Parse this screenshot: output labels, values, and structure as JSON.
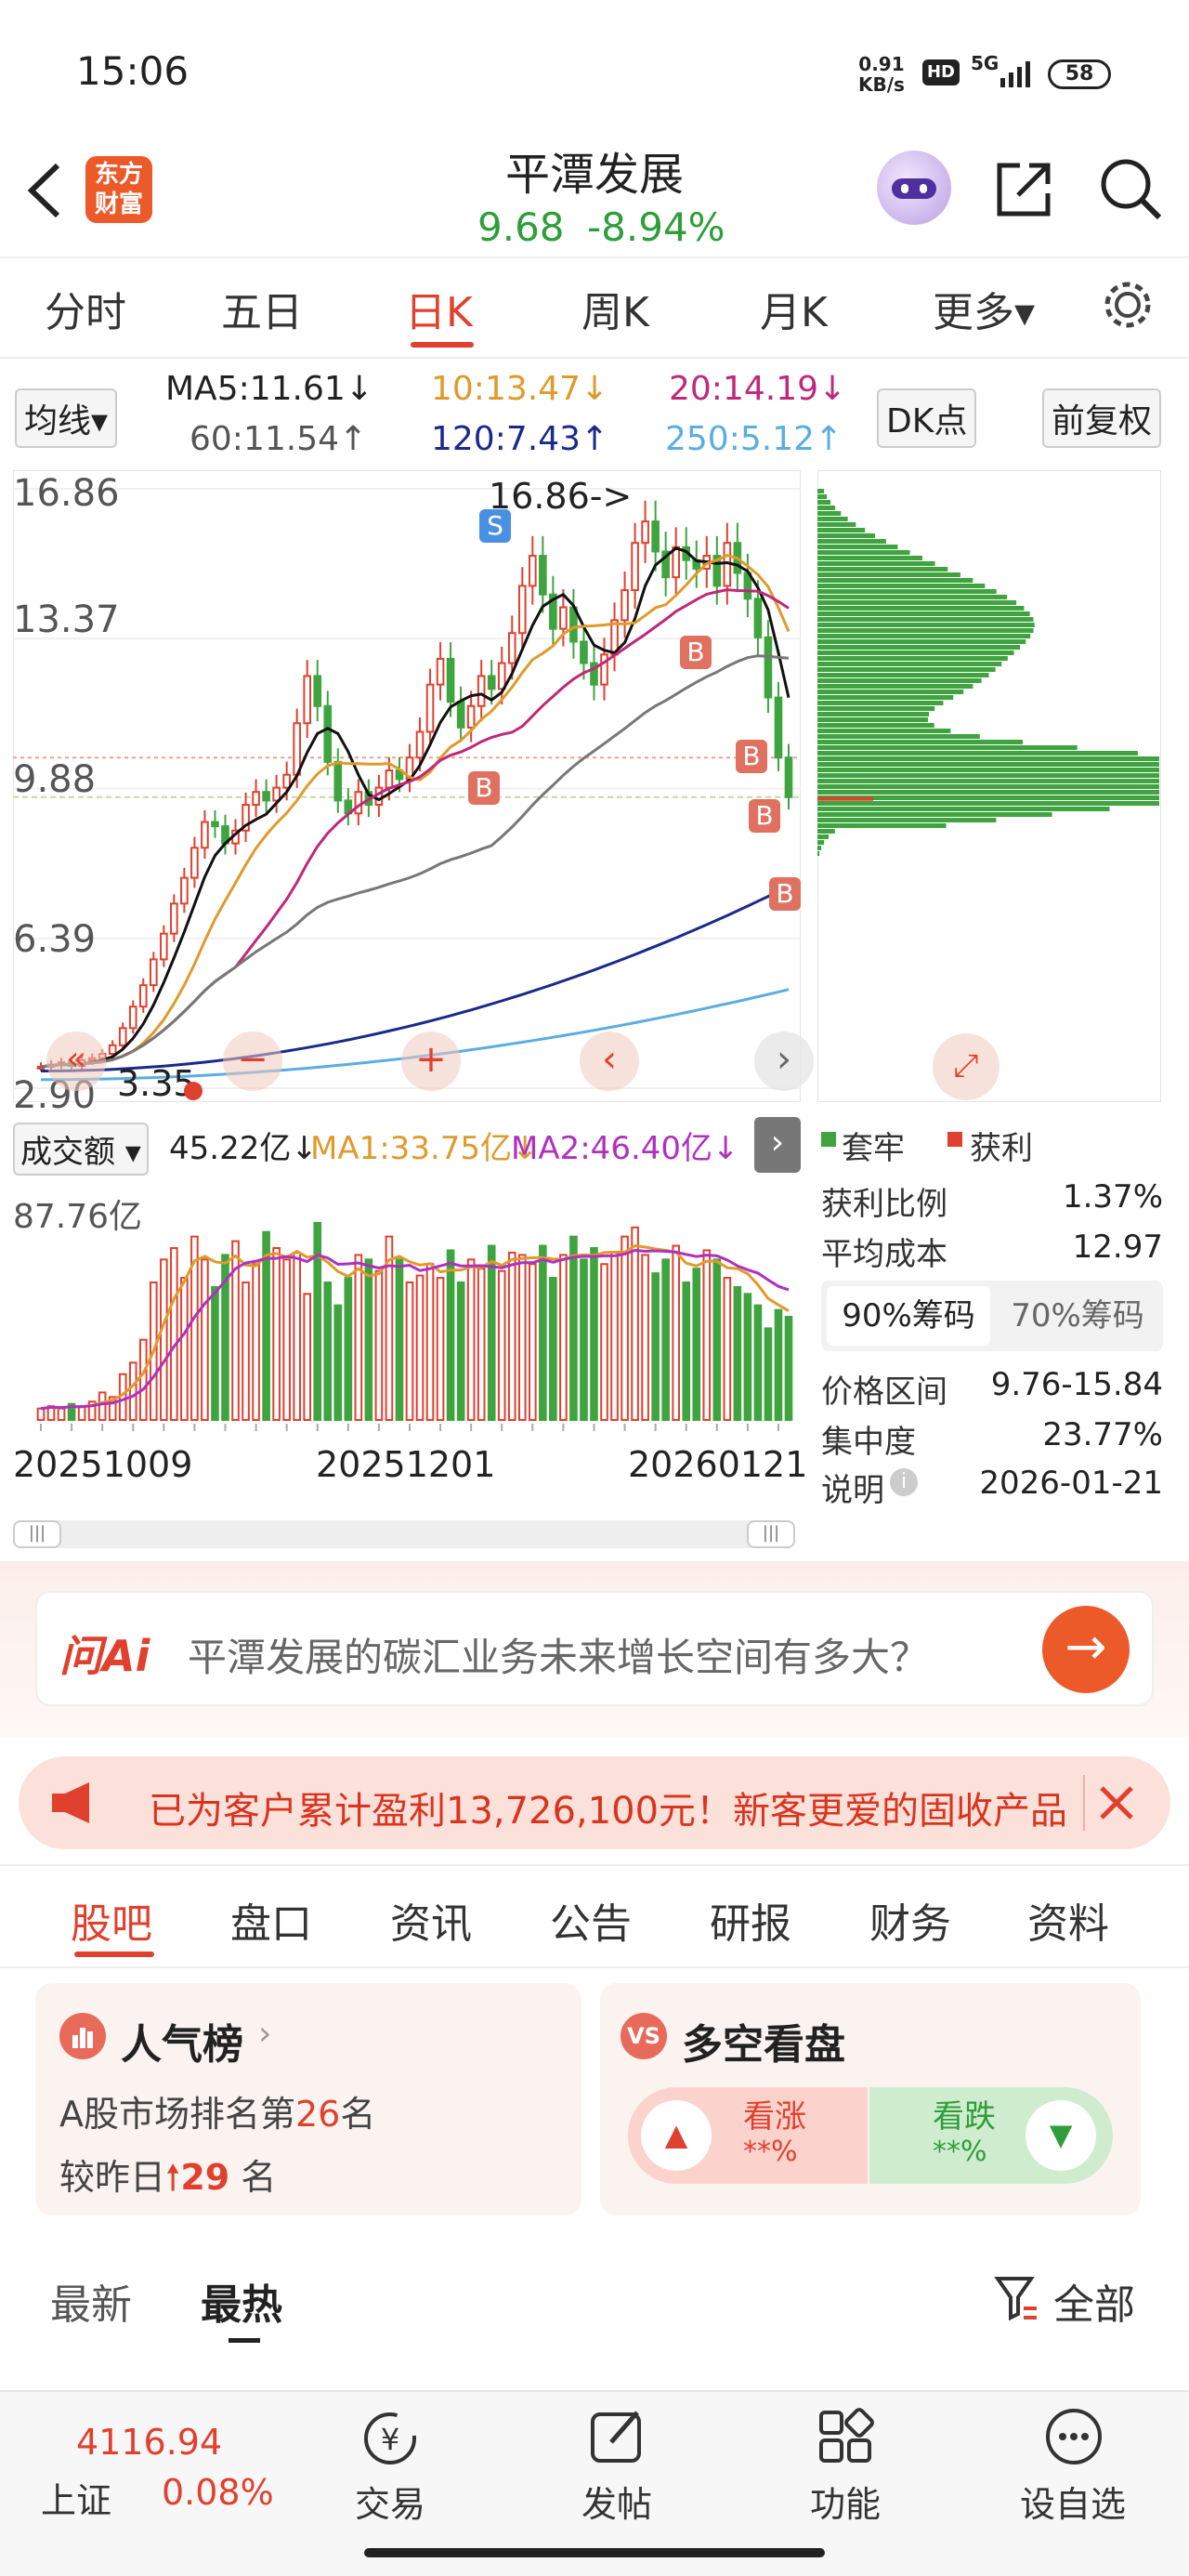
{
  "status_bar": {
    "time": "15:06",
    "net_speed_value": "0.91",
    "net_speed_unit": "KB/s",
    "hd": "HD",
    "signal": "5G",
    "battery": "58"
  },
  "header": {
    "title": "平潭发展",
    "price": "9.68",
    "change": "-8.94%",
    "logo_line1": "东方",
    "logo_line2": "财富"
  },
  "chart_tabs": [
    "分时",
    "五日",
    "日K",
    "周K",
    "月K",
    "更多▾"
  ],
  "ma": {
    "selector": "均线▾",
    "ma5": "MA5:11.61↓",
    "ma10": "10:13.47↓",
    "ma20": "20:14.19↓",
    "ma60": "60:11.54↑",
    "ma120": "120:7.43↑",
    "ma250": "250:5.12↑",
    "dk": "DK点",
    "adjust": "前复权"
  },
  "price_axis": [
    "16.86",
    "13.37",
    "9.88",
    "6.39",
    "2.90"
  ],
  "annotations": {
    "high": "16.86->",
    "low": "3.35",
    "s": "S",
    "b": "B"
  },
  "volume": {
    "selector": "成交额 ▾",
    "value": "45.22亿↓",
    "ma1": "MA1:33.75亿↓",
    "ma2": "MA2:46.40亿↓",
    "axis_top": "87.76亿"
  },
  "dates": [
    "20251009",
    "20251201",
    "20260121"
  ],
  "chips": {
    "legend_hold": "套牢",
    "legend_profit": "获利",
    "rows": [
      {
        "label": "获利比例",
        "value": "1.37%"
      },
      {
        "label": "平均成本",
        "value": "12.97"
      }
    ],
    "tab_90": "90%筹码",
    "tab_70": "70%筹码",
    "rows2": [
      {
        "label": "价格区间",
        "value": "9.76-15.84"
      },
      {
        "label": "集中度",
        "value": "23.77%"
      },
      {
        "label": "说明",
        "value": "2026-01-21"
      }
    ]
  },
  "ai": {
    "brand": "问Ai",
    "question": "平潭发展的碳汇业务未来增长空间有多大？"
  },
  "banner": {
    "text": "已为客户累计盈利13,726,100元！新客更爱的固收产品"
  },
  "section_tabs": [
    "股吧",
    "盘口",
    "资讯",
    "公告",
    "研报",
    "财务",
    "资料"
  ],
  "popularity": {
    "title": "人气榜",
    "line1_prefix": "A股市场排名第",
    "rank": "26",
    "line1_suffix": "名",
    "line2_prefix": "较昨日",
    "change": "29",
    "line2_suffix": "名"
  },
  "longshort": {
    "title": "多空看盘",
    "up_label": "看涨",
    "up_value": "**%",
    "down_label": "看跌",
    "down_value": "**%"
  },
  "feed_tabs": {
    "latest": "最新",
    "hot": "最热",
    "filter": "全部"
  },
  "bottom_nav": {
    "index_value": "4116.94",
    "index_name": "上证",
    "index_change": "0.08%",
    "trade": "交易",
    "post": "发帖",
    "features": "功能",
    "watch": "设自选"
  },
  "chart_data": {
    "type": "candlestick",
    "ylim": [
      2.9,
      16.86
    ],
    "y_ticks": [
      16.86,
      13.37,
      9.88,
      6.39,
      2.9
    ],
    "x_ticks": [
      "20251009",
      "20251201",
      "20260121"
    ],
    "last_close": 9.68,
    "high": 16.86,
    "low": 3.35,
    "closes": [
      3.4,
      3.45,
      3.5,
      3.42,
      3.55,
      3.6,
      3.7,
      3.9,
      4.3,
      4.8,
      5.3,
      5.9,
      6.5,
      7.2,
      7.8,
      8.5,
      9.1,
      9.0,
      8.6,
      8.9,
      9.5,
      9.8,
      9.6,
      9.9,
      10.2,
      11.4,
      12.5,
      11.8,
      10.5,
      9.6,
      9.3,
      9.8,
      9.5,
      9.9,
      10.3,
      10.1,
      10.6,
      11.2,
      12.3,
      12.9,
      11.9,
      11.3,
      11.8,
      12.5,
      12.2,
      12.8,
      13.5,
      14.6,
      15.3,
      14.4,
      13.6,
      14.1,
      13.3,
      12.8,
      12.3,
      13.0,
      13.8,
      14.5,
      15.6,
      16.1,
      15.4,
      14.8,
      15.5,
      15.2,
      15.0,
      15.3,
      14.6,
      15.6,
      14.9,
      14.3,
      13.4,
      12.0,
      10.6,
      9.68
    ],
    "volumes": [
      5,
      6,
      5,
      7,
      6,
      8,
      12,
      10,
      20,
      25,
      35,
      60,
      70,
      75,
      62,
      80,
      70,
      58,
      72,
      78,
      60,
      68,
      82,
      75,
      70,
      73,
      55,
      86,
      60,
      50,
      62,
      72,
      70,
      65,
      80,
      70,
      60,
      63,
      68,
      62,
      74,
      60,
      70,
      66,
      76,
      65,
      73,
      72,
      68,
      76,
      62,
      72,
      80,
      70,
      75,
      68,
      73,
      80,
      84,
      72,
      64,
      70,
      76,
      60,
      66,
      74,
      70,
      62,
      58,
      55,
      50,
      40,
      48,
      45
    ],
    "ma_values": {
      "MA5": 11.61,
      "MA10": 13.47,
      "MA20": 14.19,
      "MA60": 11.54,
      "MA120": 7.43,
      "MA250": 5.12
    }
  }
}
